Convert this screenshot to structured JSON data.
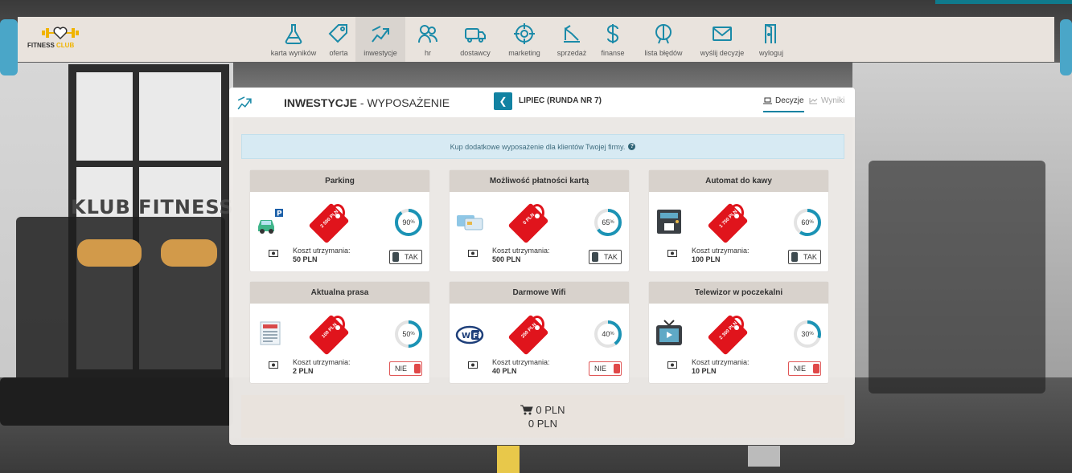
{
  "app": {
    "logo_text": "FITNESS",
    "logo_accent": "CLUB",
    "accent_color": "#1282a2"
  },
  "nav": {
    "items": [
      {
        "label": "karta wyników",
        "icon": "flask-icon"
      },
      {
        "label": "oferta",
        "icon": "tag-icon"
      },
      {
        "label": "inwestycje",
        "icon": "invest-icon",
        "active": true
      },
      {
        "label": "hr",
        "icon": "people-icon"
      },
      {
        "label": "dostawcy",
        "icon": "truck-icon"
      },
      {
        "label": "marketing",
        "icon": "target-icon"
      },
      {
        "label": "sprzedaż",
        "icon": "sales-icon"
      },
      {
        "label": "finanse",
        "icon": "dollar-icon"
      },
      {
        "label": "lista błędów",
        "icon": "bug-icon"
      },
      {
        "label": "wyślij decyzje",
        "icon": "mail-icon"
      },
      {
        "label": "wyloguj",
        "icon": "door-icon"
      }
    ]
  },
  "panel": {
    "title_bold": "INWESTYCJE",
    "title_rest": " - WYPOSAŻENIE",
    "round": "LIPIEC (RUNDA NR 7)",
    "tab_decisions": "Decyzje",
    "tab_results": "Wyniki",
    "info": "Kup dodatkowe wyposażenie dla klientów Twojej firmy.",
    "info_q": "?",
    "cost_label": "Koszt utrzymania:",
    "cards": [
      {
        "title": "Parking",
        "icon": "parking-car-icon",
        "price": "2 500 PLN",
        "percent": 90,
        "percent_label": "90",
        "cost": "50 PLN",
        "toggle": "TAK",
        "on": true
      },
      {
        "title": "Możliwość płatności kartą",
        "icon": "payment-card-icon",
        "price": "0 PLN",
        "percent": 65,
        "percent_label": "65",
        "cost": "500 PLN",
        "toggle": "TAK",
        "on": true
      },
      {
        "title": "Automat do kawy",
        "icon": "coffee-machine-icon",
        "price": "1 750 PLN",
        "percent": 60,
        "percent_label": "60",
        "cost": "100 PLN",
        "toggle": "TAK",
        "on": true
      },
      {
        "title": "Aktualna prasa",
        "icon": "newspaper-icon",
        "price": "100 PLN",
        "percent": 50,
        "percent_label": "50",
        "cost": "2 PLN",
        "toggle": "NIE",
        "on": false
      },
      {
        "title": "Darmowe Wifi",
        "icon": "wifi-icon",
        "price": "250 PLN",
        "percent": 40,
        "percent_label": "40",
        "cost": "40 PLN",
        "toggle": "NIE",
        "on": false
      },
      {
        "title": "Telewizor w poczekalni",
        "icon": "tv-icon",
        "price": "2 300 PLN",
        "percent": 30,
        "percent_label": "30",
        "cost": "10 PLN",
        "toggle": "NIE",
        "on": false
      }
    ],
    "total_cart": "0 PLN",
    "total_second": "0 PLN"
  },
  "background": {
    "sign_text": "KLUB FITNESS"
  }
}
